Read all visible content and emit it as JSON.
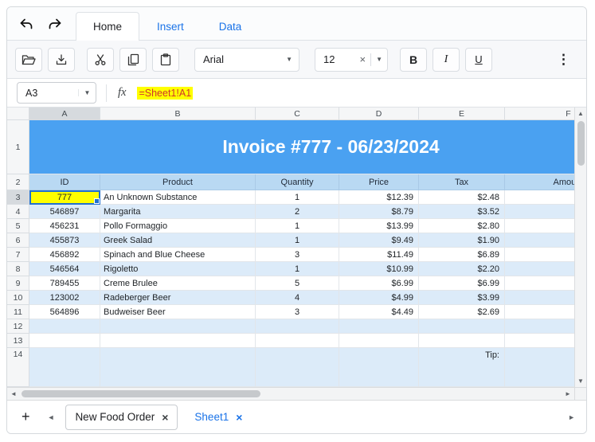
{
  "ribbon": {
    "tabs": [
      {
        "label": "Home"
      },
      {
        "label": "Insert"
      },
      {
        "label": "Data"
      }
    ],
    "font_name": "Arial",
    "font_size": "12",
    "bold": "B",
    "italic": "I",
    "underline": "U"
  },
  "formula_bar": {
    "name_box": "A3",
    "fx": "fx",
    "formula": "=Sheet1!A1"
  },
  "grid": {
    "col_headers": [
      "A",
      "B",
      "C",
      "D",
      "E",
      "F"
    ],
    "row1": {
      "n": "1",
      "title": "Invoice #777 - 06/23/2024"
    },
    "row2": {
      "n": "2",
      "headers": [
        "ID",
        "Product",
        "Quantity",
        "Price",
        "Tax",
        "Amount"
      ]
    },
    "rows": [
      {
        "n": "3",
        "cells": [
          "777",
          "An Unknown Substance",
          "1",
          "$12.39",
          "$2.48"
        ]
      },
      {
        "n": "4",
        "cells": [
          "546897",
          "Margarita",
          "2",
          "$8.79",
          "$3.52"
        ]
      },
      {
        "n": "5",
        "cells": [
          "456231",
          "Pollo Formaggio",
          "1",
          "$13.99",
          "$2.80"
        ]
      },
      {
        "n": "6",
        "cells": [
          "455873",
          "Greek Salad",
          "1",
          "$9.49",
          "$1.90"
        ]
      },
      {
        "n": "7",
        "cells": [
          "456892",
          "Spinach and Blue Cheese",
          "3",
          "$11.49",
          "$6.89"
        ]
      },
      {
        "n": "8",
        "cells": [
          "546564",
          "Rigoletto",
          "1",
          "$10.99",
          "$2.20"
        ]
      },
      {
        "n": "9",
        "cells": [
          "789455",
          "Creme Brulee",
          "5",
          "$6.99",
          "$6.99"
        ]
      },
      {
        "n": "10",
        "cells": [
          "123002",
          "Radeberger Beer",
          "4",
          "$4.99",
          "$3.99"
        ]
      },
      {
        "n": "11",
        "cells": [
          "564896",
          "Budweiser Beer",
          "3",
          "$4.49",
          "$2.69"
        ]
      }
    ],
    "empty_rows": [
      {
        "n": "12"
      },
      {
        "n": "13"
      }
    ],
    "tip_row": {
      "n": "14",
      "label": "Tip:"
    },
    "selected_cell": "A3"
  },
  "sheet_bar": {
    "tabs": [
      {
        "label": "New Food Order"
      },
      {
        "label": "Sheet1"
      }
    ]
  },
  "icons": {
    "dropdown": "▼",
    "clear": "×",
    "close": "×",
    "overflow": "⋮",
    "add": "+",
    "scroll_up": "▲",
    "scroll_down": "▼",
    "scroll_left": "◄",
    "scroll_right": "►",
    "nav_left": "◄",
    "nav_right": "►"
  }
}
